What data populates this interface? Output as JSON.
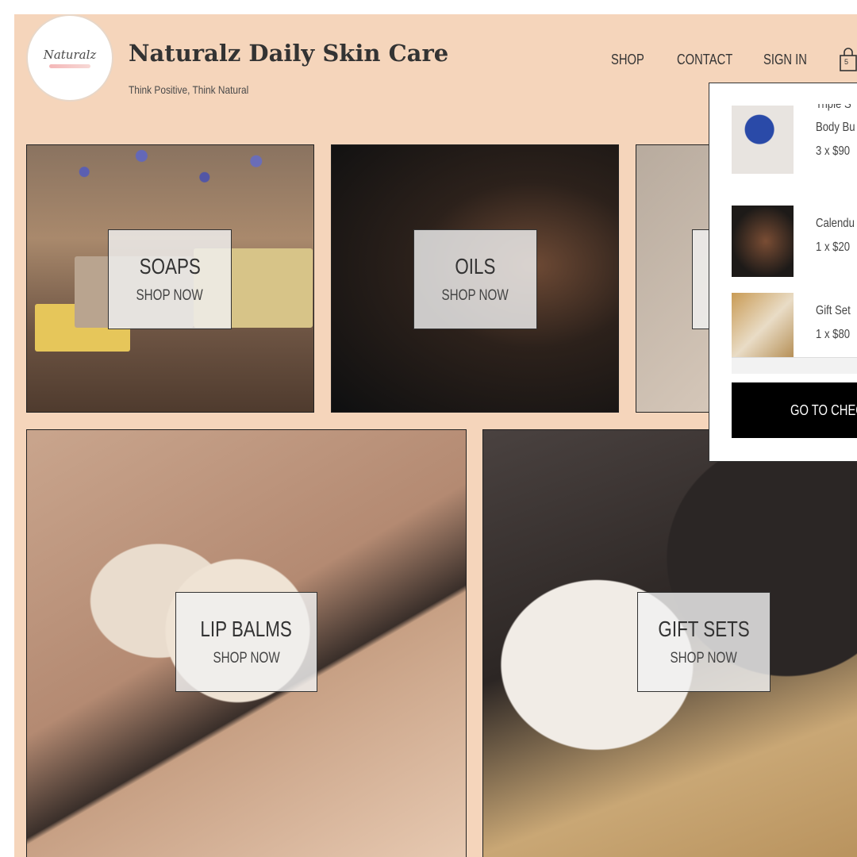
{
  "brand": {
    "logo_text": "Naturalz",
    "title": "Naturalz Daily Skin Care",
    "tagline": "Think Positive, Think Natural"
  },
  "nav": {
    "items": [
      {
        "label": "SHOP"
      },
      {
        "label": "CONTACT"
      },
      {
        "label": "SIGN IN"
      }
    ],
    "cart_icon": "cart-icon",
    "cart_count": "5"
  },
  "categories": [
    {
      "title": "SOAPS",
      "cta": "SHOP NOW"
    },
    {
      "title": "OILS",
      "cta": "SHOP NOW"
    },
    {
      "title": "",
      "cta": ""
    },
    {
      "title": "LIP BALMS",
      "cta": "SHOP NOW"
    },
    {
      "title": "GIFT SETS",
      "cta": "SHOP NOW"
    }
  ],
  "cart": {
    "items": [
      {
        "name_line1": "Triple S",
        "name_line2": "Body Bu",
        "qty_price": "3 x $90"
      },
      {
        "name_line1": "Calendu",
        "qty_price": "1 x $20"
      },
      {
        "name_line1": "Gift Set",
        "qty_price": "1 x $80"
      }
    ],
    "checkout_label": "GO TO CHEC"
  },
  "colors": {
    "page_background": "#f5d5bb",
    "checkout_button": "#000000",
    "overlay": "#f0f0f0"
  }
}
